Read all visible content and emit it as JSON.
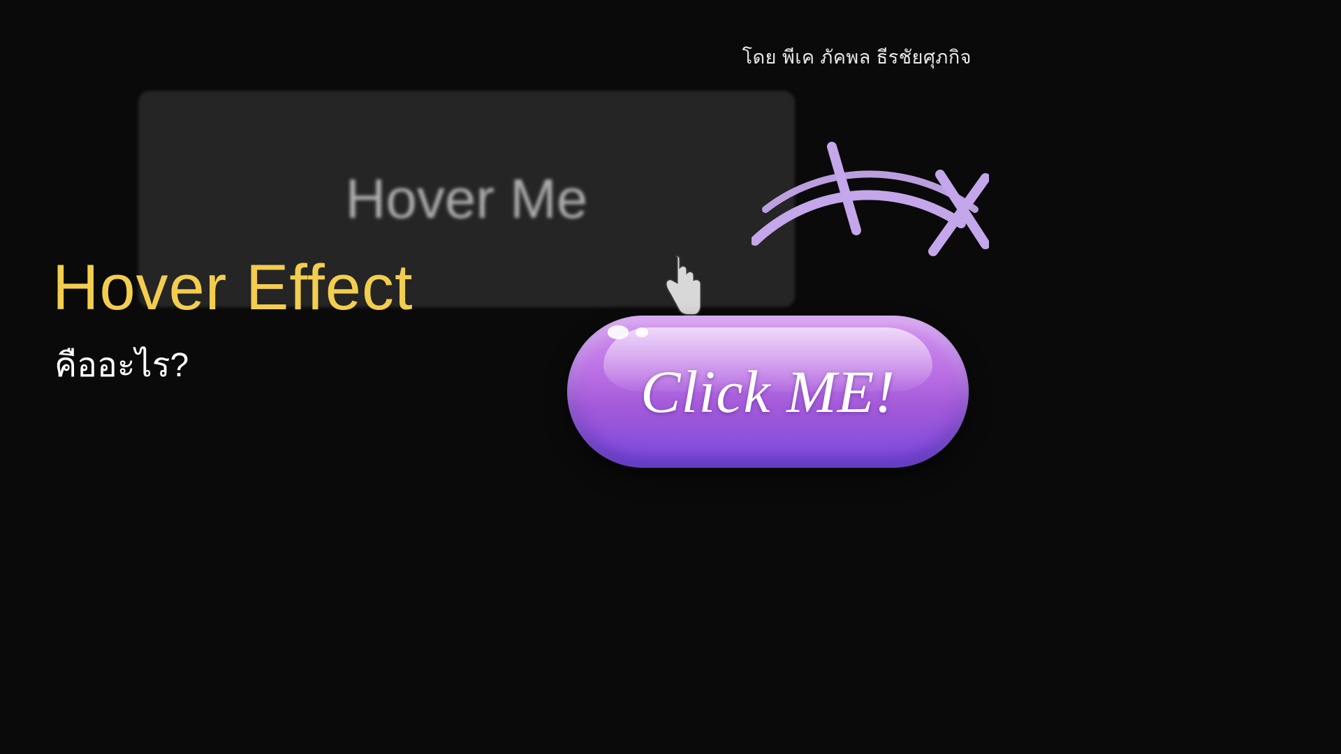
{
  "credit": "โดย พีเค ภัคพล ธีรชัยศุภกิจ",
  "hover_panel": {
    "label": "Hover Me"
  },
  "title": "Hover Effect",
  "subtitle": "คืออะไร?",
  "click_button": {
    "label": "Click ME!"
  },
  "colors": {
    "background": "#0a0a0a",
    "title": "#f3cd4e",
    "subtitle": "#ffffff",
    "panel": "#252525",
    "button_top": "#d495f0",
    "button_bottom": "#7a4ae0",
    "scribble": "#c4a6ea"
  }
}
